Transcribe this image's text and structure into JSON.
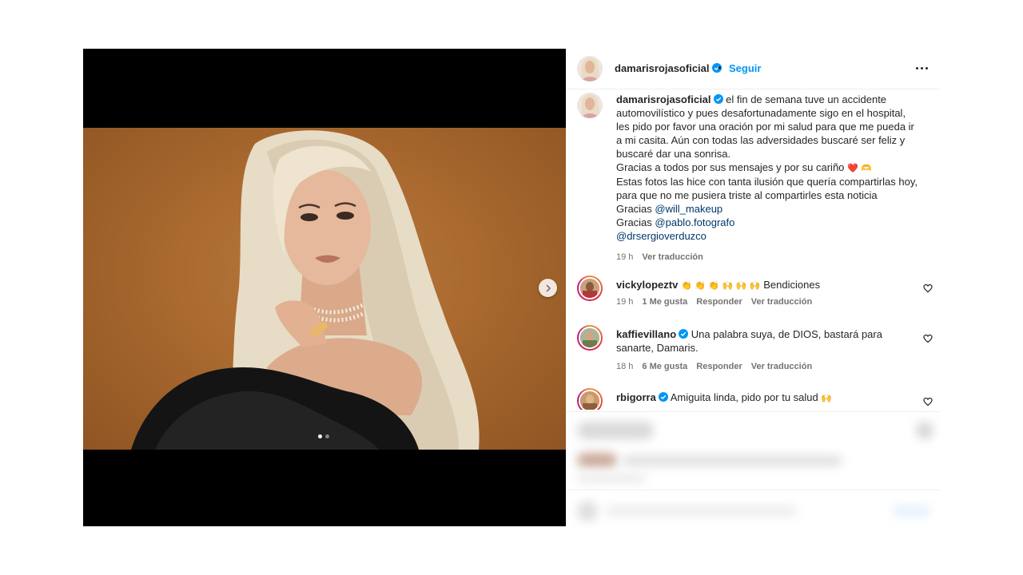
{
  "post": {
    "username": "damarisrojasoficial",
    "follow_label": "Seguir",
    "separator": "•",
    "more_label": "Más opciones",
    "next_label": "Siguiente",
    "carousel": {
      "count": 2,
      "active_index": 0
    }
  },
  "caption": {
    "username": "damarisrojasoficial",
    "text_1": "el fin de semana tuve un accidente automovilístico y pues desafortunadamente sigo en el hospital, les pido por favor una oración por mi salud para que me pueda ir a mi casita. Aún con todas las adversidades buscaré ser feliz y buscaré dar una sonrisa.",
    "text_2": "Gracias a todos por sus mensajes y por su cariño",
    "text_2_emoji": "❤️ 🫶",
    "text_3": "Estas fotos las hice con tanta ilusión que quería compartirlas hoy, para que no me pusiera triste al compartirles esta noticia",
    "thanks_1_prefix": "Gracias",
    "thanks_1_mention": "@will_makeup",
    "thanks_2_prefix": "Gracias",
    "thanks_2_mention": "@pablo.fotografo",
    "mention_3": "@drsergioverduzco",
    "time": "19 h",
    "translate": "Ver traducción"
  },
  "comments": [
    {
      "username": "vickylopeztv",
      "emoji": "👏 👏 👏 🙌 🙌 🙌",
      "text": "Bendiciones",
      "time": "19 h",
      "likes": "1 Me gusta",
      "reply": "Responder",
      "translate": "Ver traducción"
    },
    {
      "username": "kaffievillano",
      "text": "Una palabra suya, de DIOS, bastará para sanarte, Damaris.",
      "time": "18 h",
      "likes": "6 Me gusta",
      "reply": "Responder",
      "translate": "Ver traducción"
    },
    {
      "username": "rbigorra",
      "text": "Amiguita linda, pido por tu salud",
      "emoji": "🙌"
    }
  ],
  "colors": {
    "link": "#00376b",
    "follow": "#0095f6",
    "verified": "#0095f6",
    "muted": "#737373"
  },
  "icons": {
    "verified": "verified-badge-icon",
    "heart": "heart-outline-icon",
    "next": "chevron-right-icon",
    "more": "ellipsis-icon"
  }
}
